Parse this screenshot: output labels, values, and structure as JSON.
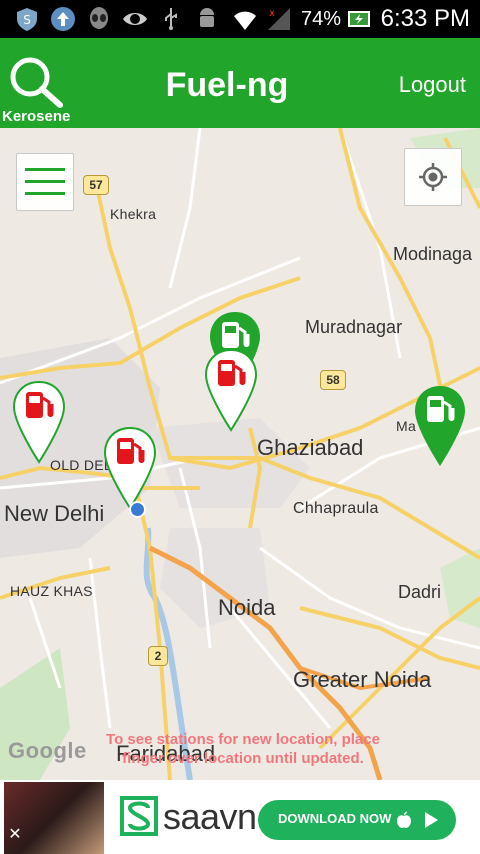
{
  "status_bar": {
    "battery_percent": "74%",
    "time": "6:33 PM",
    "icons": [
      "shield-icon",
      "upload-icon",
      "alien-icon",
      "eye-icon",
      "usb-icon",
      "android-icon",
      "wifi-icon",
      "signal-icon",
      "battery-icon"
    ]
  },
  "header": {
    "search_sublabel": "Kerosene",
    "title": "Fuel-ng",
    "logout_label": "Logout",
    "background_color": "#22a52b"
  },
  "map": {
    "places": {
      "khekra": "Khekra",
      "modinagar": "Modinaga",
      "muradnagar": "Muradnagar",
      "ghaziabad": "Ghaziabad",
      "old_delhi": "OLD DELH",
      "new_delhi": "New Delhi",
      "chhapraula": "Chhapraula",
      "hauz_khas": "HAUZ KHAS",
      "noida": "Noida",
      "dadri": "Dadri",
      "greater_noida": "Greater Noida",
      "faridabad": "Faridabad",
      "masuri": "Ma"
    },
    "highway_shields": {
      "nh57": "57",
      "nh58": "58",
      "nh2": "2"
    },
    "attribution": "Google",
    "hint": "To see stations for new location, place finger over location until updated.",
    "marker_colors": {
      "available": "#22a52b",
      "unavailable": "#e3161c"
    },
    "markers": [
      "green",
      "red",
      "red",
      "red",
      "green"
    ]
  },
  "ad": {
    "brand": "saavn",
    "cta_label": "DOWNLOAD NOW",
    "cta_color": "#20b15c",
    "close_icon": "close-icon"
  }
}
